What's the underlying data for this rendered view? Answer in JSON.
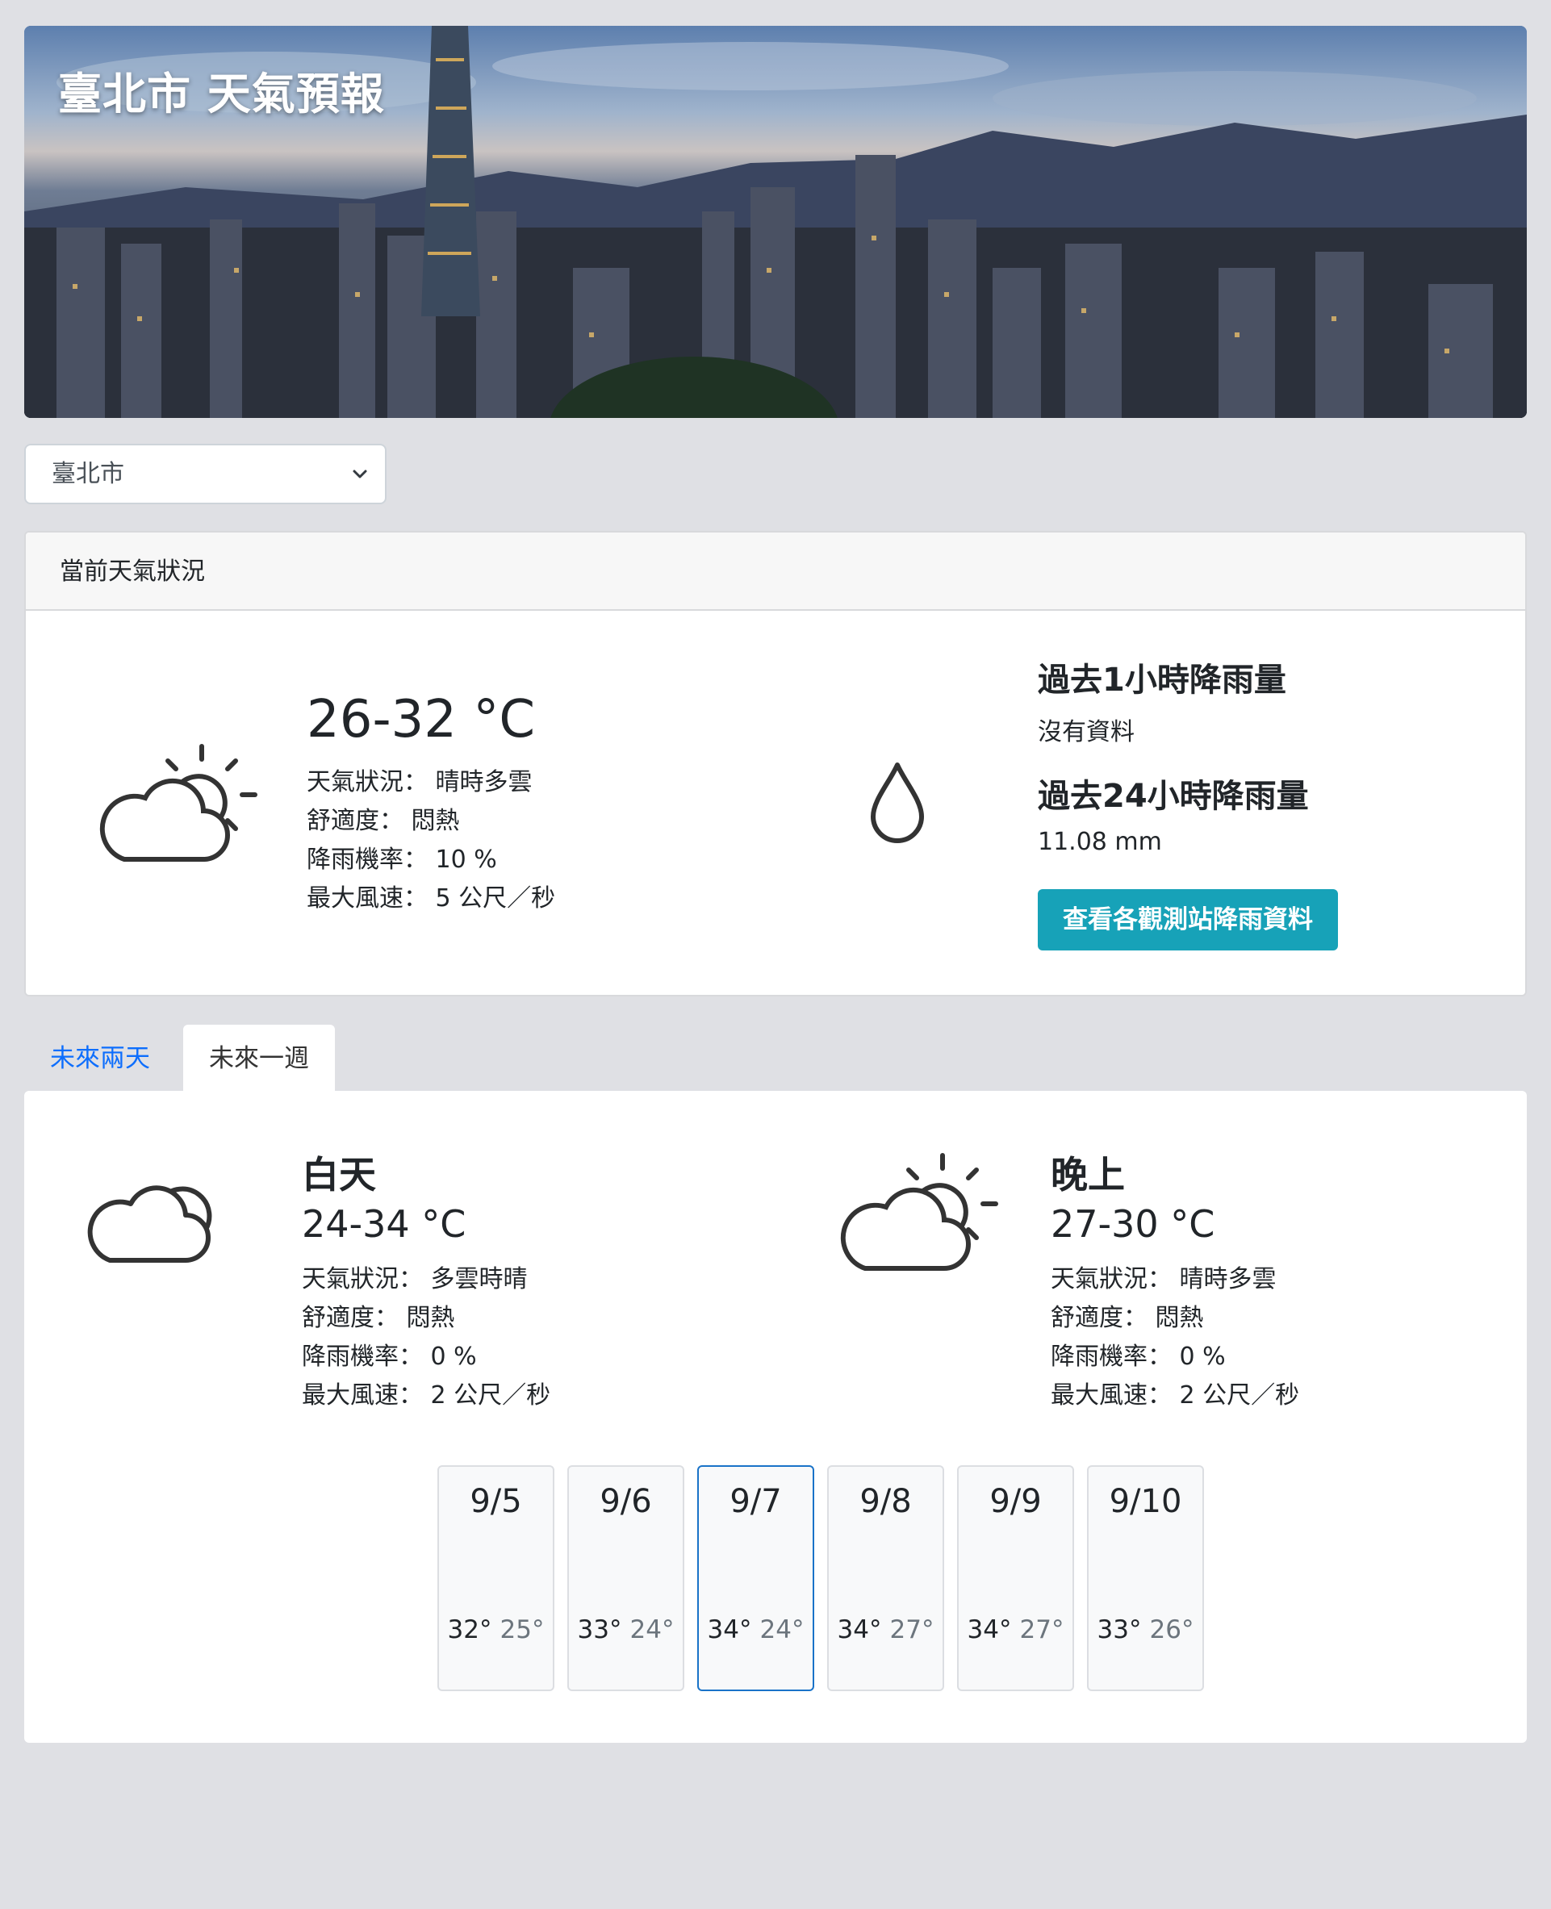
{
  "banner": {
    "title": "臺北市 天氣預報"
  },
  "city_select": {
    "value": "臺北市",
    "icon": "chevron-down-icon"
  },
  "current": {
    "header": "當前天氣狀況",
    "temp": "26-32 °C",
    "lines": [
      "天氣狀況： 晴時多雲",
      "舒適度： 悶熱",
      "降雨機率： 10 %",
      "最大風速： 5 公尺／秒"
    ],
    "rain_1h_title": "過去1小時降雨量",
    "rain_1h_value": "沒有資料",
    "rain_24h_title": "過去24小時降雨量",
    "rain_24h_value": "11.08 mm",
    "button": "查看各觀測站降雨資料",
    "weather_icon": "partly-cloudy-sun-icon",
    "rain_icon": "raindrop-icon"
  },
  "tabs": [
    {
      "label": "未來兩天",
      "active": false
    },
    {
      "label": "未來一週",
      "active": true
    }
  ],
  "forecast": {
    "day": {
      "label": "白天",
      "temp": "24-34 °C",
      "lines": [
        "天氣狀況： 多雲時晴",
        "舒適度： 悶熱",
        "降雨機率： 0 %",
        "最大風速： 2 公尺／秒"
      ],
      "icon": "cloudy-icon"
    },
    "night": {
      "label": "晚上",
      "temp": "27-30 °C",
      "lines": [
        "天氣狀況： 晴時多雲",
        "舒適度： 悶熱",
        "降雨機率： 0 %",
        "最大風速： 2 公尺／秒"
      ],
      "icon": "partly-cloudy-sun-icon"
    }
  },
  "days": [
    {
      "date": "9/5",
      "hi": "32°",
      "lo": "25°",
      "selected": false
    },
    {
      "date": "9/6",
      "hi": "33°",
      "lo": "24°",
      "selected": false
    },
    {
      "date": "9/7",
      "hi": "34°",
      "lo": "24°",
      "selected": true
    },
    {
      "date": "9/8",
      "hi": "34°",
      "lo": "27°",
      "selected": false
    },
    {
      "date": "9/9",
      "hi": "34°",
      "lo": "27°",
      "selected": false
    },
    {
      "date": "9/10",
      "hi": "33°",
      "lo": "26°",
      "selected": false
    }
  ],
  "colors": {
    "accent": "#17a2b8",
    "link": "#0d6efd",
    "selected_border": "#1a73c8",
    "background": "#dfe0e4"
  }
}
